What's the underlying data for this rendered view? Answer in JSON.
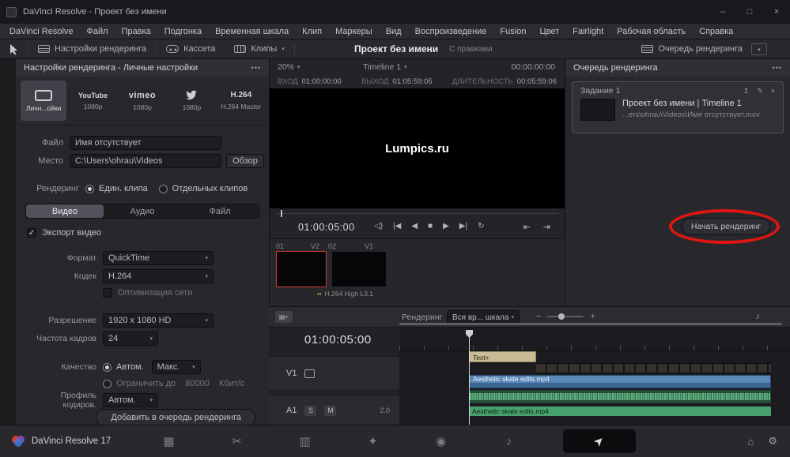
{
  "icons": {
    "dropdown": "▾",
    "menu_dots": "•••",
    "minimize": "–",
    "maximize": "□",
    "close": "×",
    "speaker": "◁)",
    "first_frame": "|◀",
    "prev_frame": "◀",
    "stop": "■",
    "play": "▶",
    "last_frame": "▶|",
    "loop": "↻",
    "to_in": "⇥",
    "to_out": "⇤",
    "music": "♪",
    "home": "⌂",
    "gear": "⚙",
    "pencil": "✎",
    "export_up": "↥",
    "cache_dots": "••",
    "zoom_minus": "−",
    "zoom_plus": "+",
    "media_page": "▦",
    "cut_page": "✂",
    "edit_page": "▥",
    "fusion_page": "✦",
    "color_page": "◉",
    "fairlight_page": "♪",
    "deliver_page": "➤",
    "film_plus": "▤+"
  },
  "titlebar": {
    "title": "DaVinci Resolve - Проект без имени"
  },
  "menubar": {
    "items": [
      "DaVinci Resolve",
      "Файл",
      "Правка",
      "Подгонка",
      "Временная шкала",
      "Клип",
      "Маркеры",
      "Вид",
      "Воспроизведение",
      "Fusion",
      "Цвет",
      "Fairlight",
      "Рабочая область",
      "Справка"
    ]
  },
  "toolbar": {
    "render_settings": "Настройки рендеринга",
    "tape": "Кассета",
    "clips": "Клипы",
    "project_title": "Проект без имени",
    "project_status": "С правками",
    "render_queue": "Очередь рендеринга"
  },
  "render_settings_panel": {
    "header": "Настройки рендеринга - Личные настройки",
    "presets": [
      {
        "label": "Личн...ойки",
        "logo_text": ""
      },
      {
        "label": "1080p",
        "logo_text": "YouTube"
      },
      {
        "label": "1080p",
        "logo_text": "vimeo"
      },
      {
        "label": "1080p",
        "logo_text": ""
      },
      {
        "label": "H.264 Master",
        "logo_text": "H.264"
      }
    ],
    "file_label": "Файл",
    "file_value": "Имя отсутствует",
    "location_label": "Место",
    "location_value": "C:\\Users\\ohrau\\Videos",
    "browse_button": "Обзор",
    "render_label": "Рендеринг",
    "render_single": "Един. клипа",
    "render_individual": "Отдельных клипов",
    "tabs": [
      "Видео",
      "Аудио",
      "Файл"
    ],
    "export_video": "Экспорт видео",
    "format_label": "Формат",
    "format_value": "QuickTime",
    "codec_label": "Кодек",
    "codec_value": "H.264",
    "network_opt": "Оптимизация сети",
    "resolution_label": "Разрешение",
    "resolution_value": "1920 x 1080 HD",
    "framerate_label": "Частота кадров",
    "framerate_value": "24",
    "quality_label": "Качество",
    "quality_auto": "Автом.",
    "quality_max": "Макс.",
    "quality_restrict": "Ограничить до",
    "quality_restrict_value": "80000",
    "quality_restrict_unit": "Кбит/с",
    "encoding_profile_label": "Профиль кодиров.",
    "encoding_profile_value": "Автом.",
    "add_to_queue_button": "Добавить в очередь рендеринга"
  },
  "viewer": {
    "zoom": "20%",
    "timeline_name": "Timeline 1",
    "header_timecode": "00:00:00:00",
    "in_label": "ВХОД",
    "in_value": "01:00:00:00",
    "out_label": "ВЫХОД",
    "out_value": "01:05:59:05",
    "duration_label": "ДЛИТЕЛЬНОСТЬ",
    "duration_value": "00:05:59:06",
    "watermark": "Lumpics.ru",
    "transport_timecode": "01:00:05:00",
    "clip1_index": "01",
    "clip1_track": "V2",
    "clip2_index": "02",
    "clip2_track": "V1",
    "codec_caption": "H.264 High L3.1"
  },
  "render_queue_panel": {
    "header": "Очередь рендеринга",
    "job": {
      "title": "Задание 1",
      "name": "Проект без имени | Timeline 1",
      "path": "...ers\\ohrau\\Videos\\Имя отсутствует.mov"
    },
    "start_render_button": "Начать рендеринг"
  },
  "timeline": {
    "render_label": "Рендеринг",
    "range_value": "Вся вр... шкала",
    "timecode": "01:00:05:00",
    "tracks": [
      {
        "id": "V1"
      },
      {
        "id": "A1",
        "solo": "S",
        "mute": "M",
        "channels": "2.0"
      }
    ],
    "clips": {
      "title_clip": "Text+",
      "video_clip": "Aesthetic skate edits.mp4",
      "audio_clip": "Aesthetic skate edits.mp4"
    }
  },
  "statusbar": {
    "app_version": "DaVinci Resolve 17"
  }
}
